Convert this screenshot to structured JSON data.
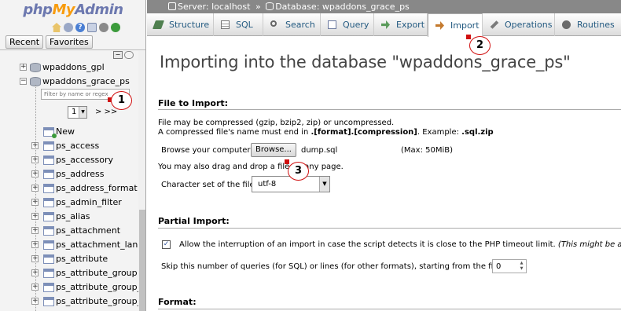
{
  "logo": {
    "php": "php",
    "my": "My",
    "admin": "Admin"
  },
  "nav": {
    "tabs": [
      "Recent",
      "Favorites"
    ],
    "filter_placeholder": "Filter by name or regex",
    "page_select_value": "1",
    "page_next": "> >>",
    "tree": [
      {
        "label": "wpaddons_gpl",
        "kind": "db",
        "expander": "+"
      },
      {
        "label": "wpaddons_grace_ps",
        "kind": "db",
        "expander": "−"
      },
      {
        "label": "New",
        "kind": "new"
      },
      {
        "label": "ps_access",
        "kind": "table"
      },
      {
        "label": "ps_accessory",
        "kind": "table"
      },
      {
        "label": "ps_address",
        "kind": "table"
      },
      {
        "label": "ps_address_format",
        "kind": "table"
      },
      {
        "label": "ps_admin_filter",
        "kind": "table"
      },
      {
        "label": "ps_alias",
        "kind": "table"
      },
      {
        "label": "ps_attachment",
        "kind": "table"
      },
      {
        "label": "ps_attachment_lang",
        "kind": "table"
      },
      {
        "label": "ps_attribute",
        "kind": "table"
      },
      {
        "label": "ps_attribute_group",
        "kind": "table"
      },
      {
        "label": "ps_attribute_group_lang",
        "kind": "table"
      },
      {
        "label": "ps_attribute_group_shop",
        "kind": "table"
      }
    ]
  },
  "breadcrumb": {
    "server": "Server: localhost",
    "separator": "»",
    "database": "Database: wpaddons_grace_ps"
  },
  "tabs": [
    {
      "label": "Structure",
      "icon": "structure-icon"
    },
    {
      "label": "SQL",
      "icon": "sql-icon"
    },
    {
      "label": "Search",
      "icon": "search-icon"
    },
    {
      "label": "Query",
      "icon": "query-icon"
    },
    {
      "label": "Export",
      "icon": "export-icon"
    },
    {
      "label": "Import",
      "icon": "import-icon",
      "active": true
    },
    {
      "label": "Operations",
      "icon": "operations-icon"
    },
    {
      "label": "Routines",
      "icon": "routines-icon"
    }
  ],
  "main": {
    "title": "Importing into the database \"wpaddons_grace_ps\"",
    "file_section": {
      "heading": "File to Import:",
      "help_line1": "File may be compressed (gzip, bzip2, zip) or uncompressed.",
      "help_line2_pre": "A compressed file's name must end in ",
      "help_line2_bold": ".[format].[compression]",
      "help_line2_mid": ". Example: ",
      "help_line2_example": ".sql.zip",
      "browse_label": "Browse your computer:",
      "browse_button": "Browse...",
      "file_name": "dump.sql",
      "max_size": "(Max: 50MiB)",
      "drag_drop_text": "You may also drag and drop a file on any page.",
      "charset_label": "Character set of the file:",
      "charset_value": "utf-8"
    },
    "partial_section": {
      "heading": "Partial Import:",
      "allow_interrupt_text": "Allow the interruption of an import in case the script detects it is close to the PHP timeout limit.",
      "allow_interrupt_note": "(This might be a good way to",
      "allow_interrupt_checked": true,
      "skip_label": "Skip this number of queries (for SQL) or lines (for other formats), starting from the first one:",
      "skip_value": "0"
    },
    "format_section": {
      "heading": "Format:"
    }
  },
  "callouts": [
    "1",
    "2",
    "3"
  ],
  "colors": {
    "callout_border": "#d01010",
    "tab_text": "#235a81",
    "breadcrumb_bg": "#888888"
  }
}
